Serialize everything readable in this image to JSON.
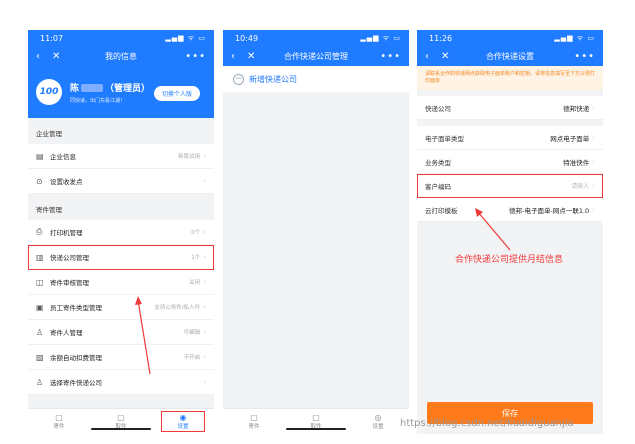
{
  "phone1": {
    "time": "11:07",
    "status_icons": "▂▄▆ ᯤ ▭",
    "title": "我的信息",
    "profile": {
      "logo": "100",
      "name_prefix": "陈",
      "role": "（管理员）",
      "subtitle": "同快递，出门先看江湖！",
      "switch_label": "切换个人版"
    },
    "section1": "企业管理",
    "section1_items": [
      {
        "label": "企业信息",
        "value": "新版试用"
      },
      {
        "label": "设置收发点",
        "value": ""
      }
    ],
    "section2": "寄件管理",
    "section2_items": [
      {
        "label": "打印机管理",
        "value": "0个"
      },
      {
        "label": "快递公司管理",
        "value": "1个"
      },
      {
        "label": "寄件审核管理",
        "value": "关闭"
      },
      {
        "label": "员工寄件类型管理",
        "value": "支持公务件/私人件"
      },
      {
        "label": "寄件人管理",
        "value": "可编辑"
      },
      {
        "label": "余额自动扣费管理",
        "value": "不开启"
      },
      {
        "label": "选择寄件快递公司",
        "value": ""
      }
    ],
    "tabs": [
      "寄件",
      "取件",
      "设置"
    ]
  },
  "phone2": {
    "time": "10:49",
    "status_icons": "▂▄▆ ᯤ ▭",
    "title": "合作快递公司管理",
    "add_label": "新增快递公司",
    "tabs": [
      "寄件",
      "取件",
      "设置"
    ]
  },
  "phone3": {
    "time": "11:26",
    "status_icons": "▂▄▆ ᯤ ▭",
    "title": "合作快递设置",
    "notice": "请联系合作的快递网点获取电子面单账户和密钥。请将信息填写至下方以便打印面单",
    "fields": [
      {
        "label": "快递公司",
        "value": "德邦快递",
        "placeholder": ""
      },
      {
        "label": "电子面单类型",
        "value": "网点电子面单",
        "placeholder": ""
      },
      {
        "label": "业务类型",
        "value": "特准快件",
        "placeholder": ""
      },
      {
        "label": "客户编码",
        "value": "",
        "placeholder": "请输入"
      },
      {
        "label": "云打印模板",
        "value": "德邦-电子面单-网点一联1.0",
        "placeholder": ""
      }
    ],
    "save_label": "保存"
  },
  "annotation": "合作快递公司提供月结信息",
  "watermark": "https://blog.csdn.net/kuaidiguanjia",
  "colors": {
    "brand": "#1f7bff",
    "highlight": "#ef3a3a",
    "save": "#ff7a1a"
  }
}
